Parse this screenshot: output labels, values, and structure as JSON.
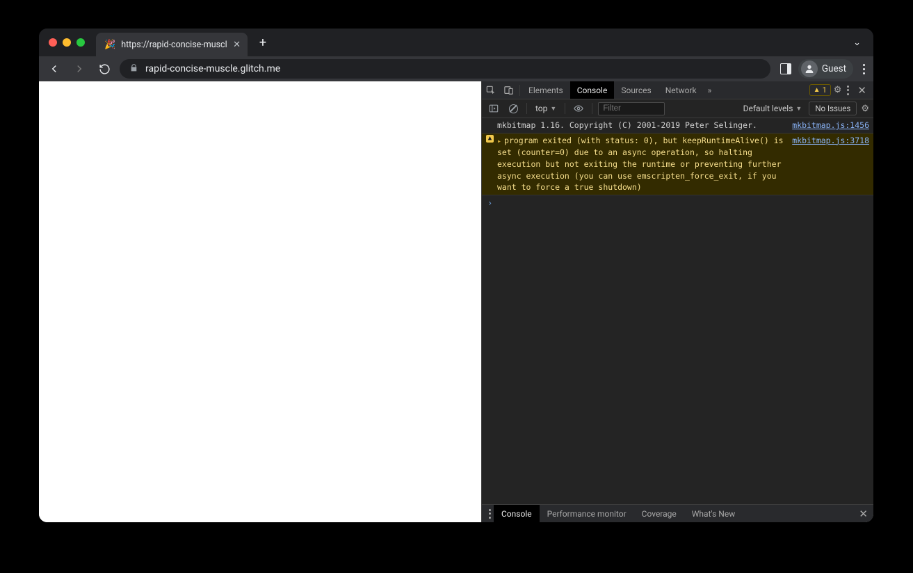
{
  "browser": {
    "tab_title": "https://rapid-concise-muscle.g",
    "url_display": "rapid-concise-muscle.glitch.me",
    "guest_label": "Guest"
  },
  "devtools": {
    "tabs": {
      "elements": "Elements",
      "console": "Console",
      "sources": "Sources",
      "network": "Network"
    },
    "warning_count": "1",
    "console_toolbar": {
      "context_label": "top",
      "filter_placeholder": "Filter",
      "levels_label": "Default levels",
      "issues_label": "No Issues"
    },
    "log": {
      "info_msg": "mkbitmap 1.16. Copyright (C) 2001-2019 Peter Selinger.",
      "info_src": "mkbitmap.js:1456",
      "warn_msg": "program exited (with status: 0), but keepRuntimeAlive() is set (counter=0) due to an async operation, so halting execution but not exiting the runtime or preventing further async execution (you can use emscripten_force_exit, if you want to force a true shutdown)",
      "warn_src": "mkbitmap.js:3718"
    },
    "drawer": {
      "console": "Console",
      "perf": "Performance monitor",
      "coverage": "Coverage",
      "whatsnew": "What's New"
    }
  }
}
